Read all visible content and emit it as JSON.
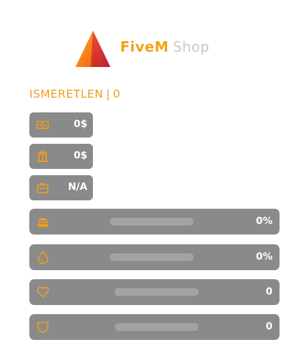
{
  "logo": {
    "brand": "FiveM",
    "sub": "Shop"
  },
  "identity": {
    "name": "ISMERETLEN",
    "separator": "|",
    "id": "0"
  },
  "stats": {
    "cash": {
      "icon": "cash-icon",
      "value": "0$"
    },
    "bank": {
      "icon": "bank-icon",
      "value": "0$"
    },
    "job": {
      "icon": "briefcase-icon",
      "value": "N/A"
    }
  },
  "status_bars": {
    "hunger": {
      "icon": "burger-icon",
      "label": "0%",
      "level": 0
    },
    "thirst": {
      "icon": "water-drop-icon",
      "label": "0%",
      "level": 0
    },
    "health": {
      "icon": "heart-icon",
      "label": "0",
      "level": 0
    },
    "armor": {
      "icon": "shield-icon",
      "label": "0",
      "level": 0
    }
  },
  "colors": {
    "accent": "#f29d1a",
    "panel": "#8a8a8a",
    "track": "#a3a3a3",
    "text": "#ffffff"
  }
}
